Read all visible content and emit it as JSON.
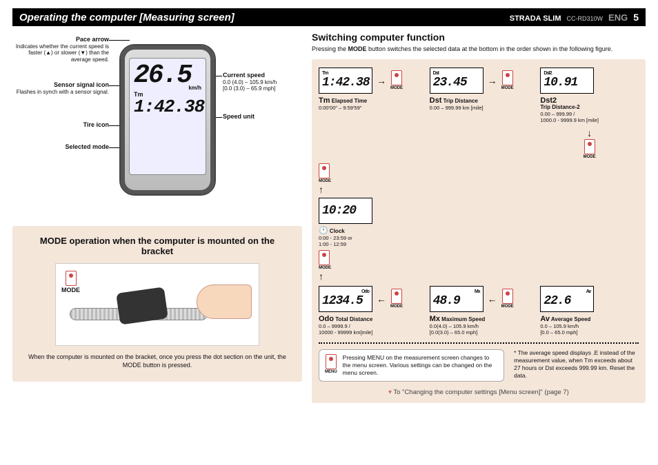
{
  "header": {
    "title": "Operating the computer [Measuring screen]",
    "product_bold": "STRADA SLIM",
    "product_code": "CC-RD310W",
    "lang": "ENG",
    "page": "5"
  },
  "left": {
    "callouts": {
      "pace_arrow": {
        "title": "Pace arrow",
        "body": "Indicates whether the current speed is faster (▲) or slower (▼) than the average speed."
      },
      "sensor": {
        "title": "Sensor signal icon",
        "body": "Flashes in synch with a sensor signal."
      },
      "tire": {
        "title": "Tire icon"
      },
      "selected_mode": {
        "title": "Selected mode"
      },
      "current_speed": {
        "title": "Current speed",
        "body": "0.0 (4.0) – 105.9 km/h\n[0.0 (3.0) – 65.9 mph]"
      },
      "speed_unit": {
        "title": "Speed unit"
      }
    },
    "screen": {
      "speed": "26.5",
      "kmh": "km/h",
      "tm_label": "Tm",
      "tm_value": "1:42.38"
    },
    "mode_box": {
      "heading": "MODE operation when the computer is mounted on the bracket",
      "mode_label": "MODE",
      "caption": "When the computer is mounted on the bracket, once you press the dot section on the unit, the MODE button is pressed."
    }
  },
  "right": {
    "heading": "Switching computer function",
    "lead_pre": "Pressing the ",
    "lead_bold": "MODE",
    "lead_post": " button switches the selected data at the bottom in the order shown in the following figure.",
    "mode_icon_label": "MODE",
    "menu_icon_label": "MENU",
    "modes": {
      "tm": {
        "tag": "Tm",
        "value": "1:42.38",
        "title_big": "Tm",
        "title_rest": " Elapsed Time",
        "range": "0:00'00\" – 9:59'59\""
      },
      "dst": {
        "tag": "Dst",
        "value": "23.45",
        "title_big": "Dst",
        "title_rest": " Trip Distance",
        "range": "0.00 – 999.99 km [mile]"
      },
      "dst2": {
        "tag": "Dst2",
        "value": "10.91",
        "title_big": "Dst2",
        "title_rest": "",
        "sub": "Trip Distance-2",
        "range": "0.00 – 999.99 /\n1000.0 - 9999.9 km [mile]"
      },
      "clock": {
        "tag": "",
        "value": "10:20",
        "title_big": "🕐",
        "title_rest": " Clock",
        "range": "0:00 - 23:59 or\n1:00 - 12:59"
      },
      "odo": {
        "tag": "Odo",
        "value": "1234.5",
        "title_big": "Odo",
        "title_rest": " Total Distance",
        "range": "0.0 – 9999.9 /\n10000 - 99999 km[mile]"
      },
      "mx": {
        "tag": "Mx",
        "value": "48.9",
        "title_big": "Mx",
        "title_rest": " Maximum Speed",
        "range": "0.0(4.0) – 105.9 km/h\n[0.0(3.0) – 65.0 mph]"
      },
      "av": {
        "tag": "Av",
        "value": "22.6",
        "title_big": "Av",
        "title_rest": " Average Speed",
        "range": "0.0 – 105.9 km/h\n[0.0 – 65.0 mph]"
      }
    },
    "menu_note": "Pressing MENU on the measurement screen changes to the menu screen. Various settings can be changed on the menu screen.",
    "avg_note": "* The average speed displays .E instead of the measurement value, when Tm exceeds about 27 hours or Dst exceeds 999.99 km. Reset the data.",
    "goto": "To \"Changing the computer settings [Menu screen]\" (page 7)"
  }
}
